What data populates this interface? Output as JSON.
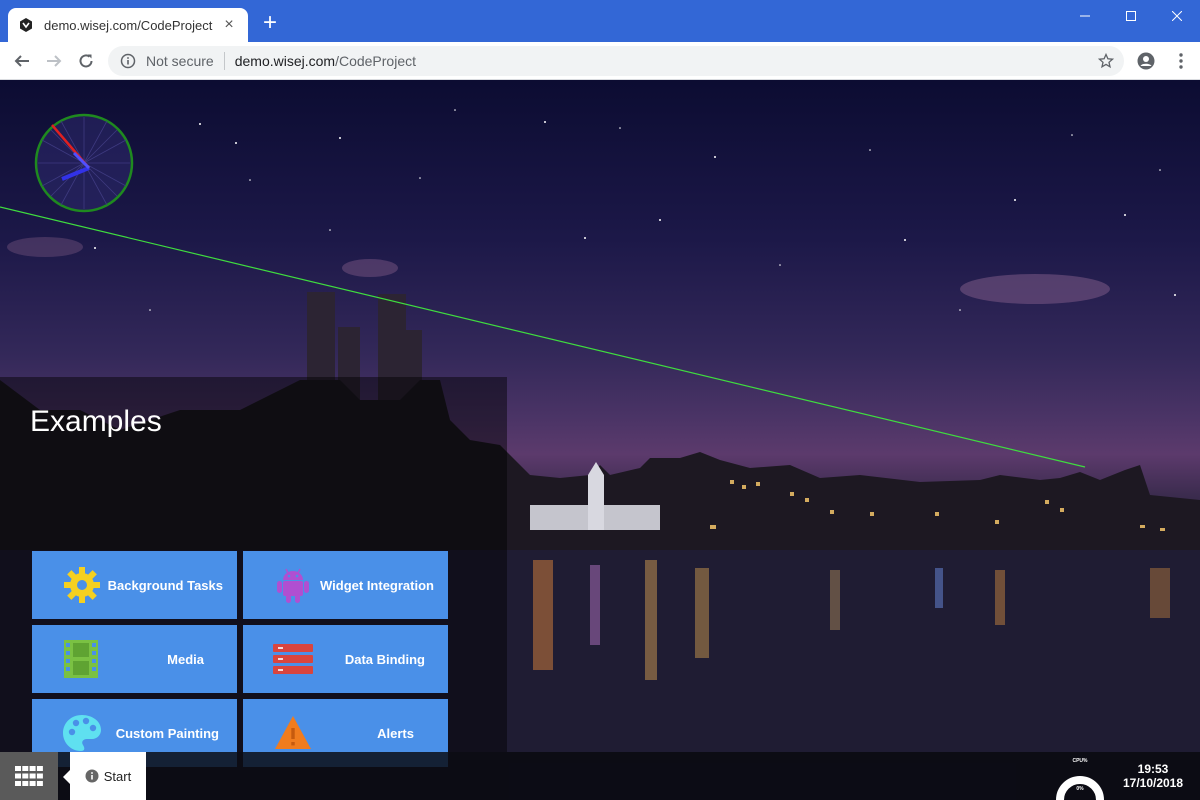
{
  "browser": {
    "tab_title": "demo.wisej.com/CodeProject",
    "new_tab_symbol": "+",
    "security_label": "Not secure",
    "url_host": "demo.wisej.com",
    "url_path": "/CodeProject"
  },
  "examples": {
    "title": "Examples",
    "tiles": [
      {
        "label": "Background Tasks",
        "icon": "gear-icon",
        "icon_color": "#f5d020"
      },
      {
        "label": "Widget Integration",
        "icon": "android-icon",
        "icon_color": "#b04fd1"
      },
      {
        "label": "Media",
        "icon": "film-icon",
        "icon_color": "#7ac143"
      },
      {
        "label": "Data Binding",
        "icon": "database-icon",
        "icon_color": "#d9453e"
      },
      {
        "label": "Custom Painting",
        "icon": "palette-icon",
        "icon_color": "#5fe0f0"
      },
      {
        "label": "Alerts",
        "icon": "warning-icon",
        "icon_color": "#f07c1e"
      }
    ]
  },
  "taskbar": {
    "start_label": "Start",
    "cpu_label": "CPU%",
    "cpu_value": "0%",
    "time": "19:53",
    "date": "17/10/2018"
  }
}
